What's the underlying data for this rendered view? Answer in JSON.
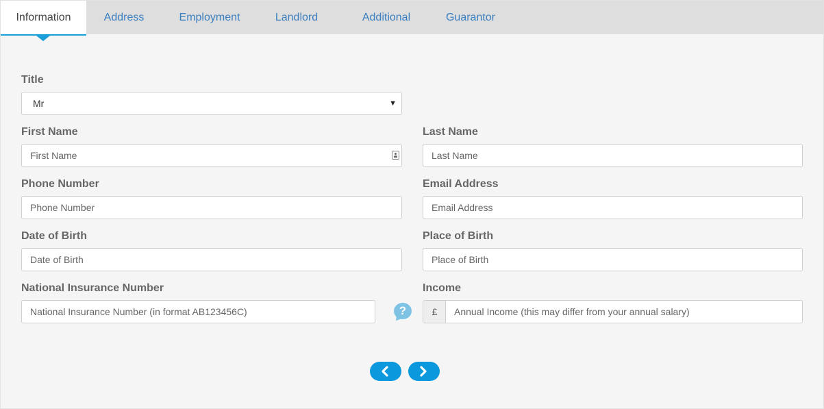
{
  "tabs": [
    {
      "label": "Information",
      "active": true
    },
    {
      "label": "Address"
    },
    {
      "label": "Employment"
    },
    {
      "label": "Landlord"
    },
    {
      "label": "Additional"
    },
    {
      "label": "Guarantor"
    }
  ],
  "form": {
    "title": {
      "label": "Title",
      "value": "Mr"
    },
    "first_name": {
      "label": "First Name",
      "placeholder": "First Name"
    },
    "last_name": {
      "label": "Last Name",
      "placeholder": "Last Name"
    },
    "phone": {
      "label": "Phone Number",
      "placeholder": "Phone Number"
    },
    "email": {
      "label": "Email Address",
      "placeholder": "Email Address"
    },
    "dob": {
      "label": "Date of Birth",
      "placeholder": "Date of Birth"
    },
    "pob": {
      "label": "Place of Birth",
      "placeholder": "Place of Birth"
    },
    "ni": {
      "label": "National Insurance Number",
      "placeholder": "National Insurance Number (in format AB123456C)"
    },
    "income": {
      "label": "Income",
      "currency": "£",
      "placeholder": "Annual Income (this may differ from your annual salary)"
    },
    "help_glyph": "?"
  },
  "icons": {
    "title_select": "dropdown-arrow-icon",
    "first_name": "contact-card-icon",
    "ni_help": "help-bubble-icon",
    "prev": "chevron-left-icon",
    "next": "chevron-right-icon"
  },
  "colors": {
    "accent": "#0b98dc",
    "tab_link": "#3a7fc1"
  }
}
